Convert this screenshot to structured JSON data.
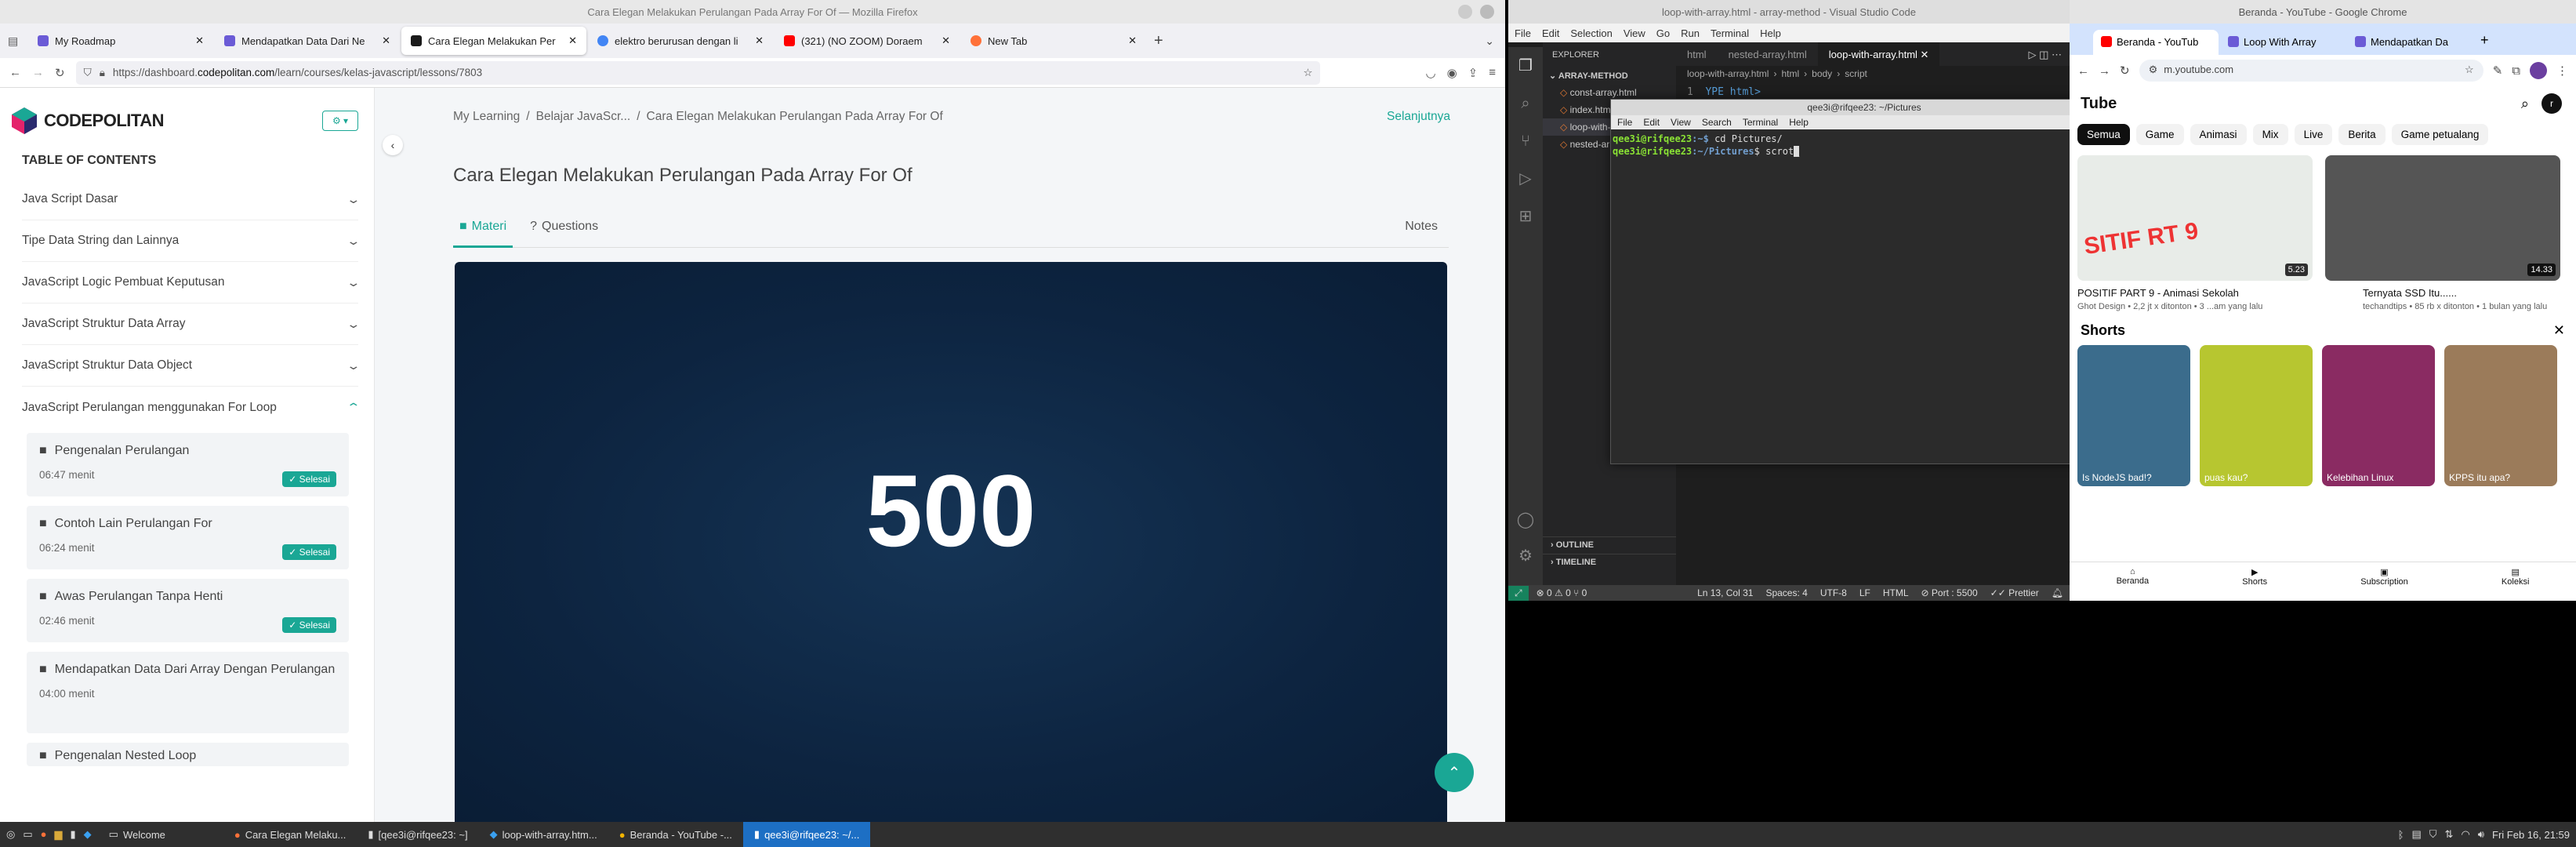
{
  "firefox": {
    "window_title": "Cara Elegan Melakukan Perulangan Pada Array For Of — Mozilla Firefox",
    "tabs": [
      "My Roadmap",
      "Mendapatkan Data Dari Ne",
      "Cara Elegan Melakukan Per",
      "elektro berurusan dengan li",
      "(321) (NO ZOOM) Doraem",
      "New Tab"
    ],
    "url_prefix": "https://dashboard.",
    "url_domain": "codepolitan.com",
    "url_path": "/learn/courses/kelas-javascript/lessons/7803"
  },
  "codepolitan": {
    "logo": "CODEPOLITAN",
    "toc_title": "TABLE OF CONTENTS",
    "sections": [
      "Java Script Dasar",
      "Tipe Data String dan Lainnya",
      "JavaScript Logic Pembuat Keputusan",
      "JavaScript Struktur Data Array",
      "JavaScript Struktur Data Object",
      "JavaScript Perulangan menggunakan For Loop"
    ],
    "lessons": [
      {
        "title": "Pengenalan Perulangan",
        "duration": "06:47 menit",
        "status": "Selesai"
      },
      {
        "title": "Contoh Lain Perulangan For",
        "duration": "06:24 menit",
        "status": "Selesai"
      },
      {
        "title": "Awas Perulangan Tanpa Henti",
        "duration": "02:46 menit",
        "status": "Selesai"
      },
      {
        "title": "Mendapatkan Data Dari Array Dengan Perulangan",
        "duration": "04:00 menit",
        "status": ""
      },
      {
        "title": "Pengenalan Nested Loop",
        "duration": "",
        "status": ""
      }
    ],
    "breadcrumb": [
      "My Learning",
      "Belajar JavaScr...",
      "Cara Elegan Melakukan Perulangan Pada Array For Of"
    ],
    "next": "Selanjutnya",
    "page_title": "Cara Elegan Melakukan Perulangan Pada Array For Of",
    "tab_materi": "Materi",
    "tab_questions": "Questions",
    "notes": "Notes",
    "video_text": "500"
  },
  "vscode": {
    "window_title": "loop-with-array.html - array-method - Visual Studio Code",
    "menu": [
      "File",
      "Edit",
      "Selection",
      "View",
      "Go",
      "Run",
      "Terminal",
      "Help"
    ],
    "explorer": "EXPLORER",
    "folder": "ARRAY-METHOD",
    "files": [
      "const-array.html",
      "index.html",
      "loop-with-array.html",
      "nested-array.html"
    ],
    "tabs": [
      "html",
      "nested-array.html",
      "loop-with-array.html"
    ],
    "breadcrumb": [
      "loop-with-array.html",
      "html",
      "body",
      "script"
    ],
    "outline": "OUTLINE",
    "timeline": "TIMELINE",
    "status_left": "⊗ 0 ⚠ 0   ⑂ 0",
    "status_items": [
      "Ln 13, Col 31",
      "Spaces: 4",
      "UTF-8",
      "LF",
      "HTML",
      "Port : 5500",
      "Prettier"
    ],
    "code_line_no": "1",
    "code_line": "YPE html>"
  },
  "terminal": {
    "title": "qee3i@rifqee23: ~/Pictures",
    "menu": [
      "File",
      "Edit",
      "View",
      "Search",
      "Terminal",
      "Help"
    ],
    "line1_prompt": "qee3i@rifqee23",
    "line1_path": ":~$ ",
    "line1_cmd": "cd Pictures/",
    "line2_prompt": "qee3i@rifqee23",
    "line2_path": ":~/Pictures",
    "line2_cmd": "$ scrot"
  },
  "chrome": {
    "window_title": "Beranda - YouTube - Google Chrome",
    "tabs": [
      "Beranda - YouTub",
      "Loop With Array",
      "Mendapatkan Da"
    ],
    "url": "m.youtube.com",
    "logo": "Tube",
    "chips": [
      "Semua",
      "Game",
      "Animasi",
      "Mix",
      "Live",
      "Berita",
      "Game petualang"
    ],
    "videos": [
      {
        "title": "POSITIF PART 9 - Animasi Sekolah",
        "meta": "Ghot Design • 2,2 jt x ditonton • 3 ...am yang lalu",
        "duration": "5.23",
        "thumb_text": "SITIF RT 9"
      },
      {
        "title": "Ternyata SSD Itu......",
        "meta": "techandtips • 85 rb x ditonton • 1 bulan yang lalu",
        "duration": "14.33"
      }
    ],
    "shorts_title": "Shorts",
    "shorts": [
      "Is NodeJS bad!?",
      "puas kau?",
      "Kelebihan Linux",
      "KPPS itu apa?"
    ],
    "nav": [
      "Beranda",
      "Shorts",
      "Subscription",
      "Koleksi"
    ]
  },
  "taskbar": {
    "items": [
      "Welcome",
      "Cara Elegan Melaku...",
      "[qee3i@rifqee23: ~]",
      "loop-with-array.htm...",
      "Beranda - YouTube -...",
      "qee3i@rifqee23: ~/..."
    ],
    "clock": "Fri Feb 16, 21:59"
  }
}
